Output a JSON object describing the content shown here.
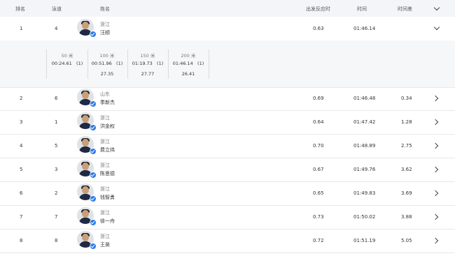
{
  "header": {
    "rank": "排名",
    "lane": "泳道",
    "name": "姓名",
    "reaction": "出发反应时",
    "time": "时间",
    "diff": "时间差"
  },
  "rows": [
    {
      "rank": "1",
      "lane": "4",
      "prov": "浙江",
      "name": "汪顺",
      "reaction": "0.63",
      "time": "01:46.14",
      "diff": "",
      "expanded": true
    },
    {
      "rank": "2",
      "lane": "6",
      "prov": "山东",
      "name": "季新杰",
      "reaction": "0.69",
      "time": "01:46.48",
      "diff": "0.34"
    },
    {
      "rank": "3",
      "lane": "1",
      "prov": "浙江",
      "name": "洪金权",
      "reaction": "0.64",
      "time": "01:47.42",
      "diff": "1.28"
    },
    {
      "rank": "4",
      "lane": "5",
      "prov": "浙江",
      "name": "费立纬",
      "reaction": "0.70",
      "time": "01:48.89",
      "diff": "2.75"
    },
    {
      "rank": "5",
      "lane": "3",
      "prov": "浙江",
      "name": "陈思德",
      "reaction": "0.67",
      "time": "01:49.76",
      "diff": "3.62"
    },
    {
      "rank": "6",
      "lane": "2",
      "prov": "浙江",
      "name": "钱智勇",
      "reaction": "0.65",
      "time": "01:49.83",
      "diff": "3.69"
    },
    {
      "rank": "7",
      "lane": "7",
      "prov": "浙江",
      "name": "徐一舟",
      "reaction": "0.73",
      "time": "01:50.02",
      "diff": "3.88"
    },
    {
      "rank": "8",
      "lane": "8",
      "prov": "浙江",
      "name": "王昊",
      "reaction": "0.72",
      "time": "01:51.19",
      "diff": "5.05"
    }
  ],
  "splits": [
    {
      "distance": "50 米",
      "time": "00:24.61",
      "rank": "(1)",
      "gap": ""
    },
    {
      "distance": "100 米",
      "time": "00:51.96",
      "rank": "(1)",
      "gap": "27.35"
    },
    {
      "distance": "150 米",
      "time": "01:19.73",
      "rank": "(1)",
      "gap": "27.77"
    },
    {
      "distance": "200 米",
      "time": "01:46.14",
      "rank": "(1)",
      "gap": "26.41"
    }
  ],
  "colors": {
    "badge": "#2e7be6",
    "header_bg": "#f3f5f8",
    "split_bg": "#f6f7f9"
  }
}
